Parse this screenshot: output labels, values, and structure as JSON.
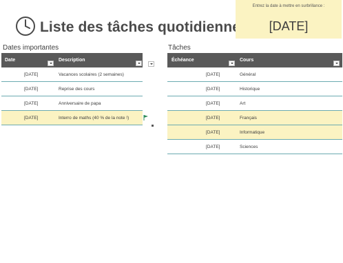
{
  "header": {
    "title": "Liste des tâches quotidiennes",
    "icon": "clock-icon"
  },
  "highlight": {
    "label": "Entrez la date à mettre en surbrillance :",
    "value": "[DATE]",
    "color": "#fbf3c2"
  },
  "important_dates": {
    "section_label": "Dates importantes",
    "columns": [
      "Date",
      "Description"
    ],
    "rows": [
      {
        "date": "[DATE]",
        "description": "Vacances scolaires (2 semaines)"
      },
      {
        "date": "[DATE]",
        "description": "Reprise des cours"
      },
      {
        "date": "[DATE]",
        "description": "Anniversaire de papa"
      },
      {
        "date": "[DATE]",
        "description": "Interro de maths (40 % de la note !)"
      }
    ]
  },
  "tasks": {
    "section_label": "Tâches",
    "columns": [
      "Échéance",
      "Cours"
    ],
    "rows": [
      {
        "due": "[DATE]",
        "course": "Général"
      },
      {
        "due": "[DATE]",
        "course": "Historique"
      },
      {
        "due": "[DATE]",
        "course": "Art"
      },
      {
        "due": "[DATE]",
        "course": "Français"
      },
      {
        "due": "[DATE]",
        "course": "Informatique"
      },
      {
        "due": "[DATE]",
        "course": "Sciences"
      }
    ]
  },
  "colors": {
    "header_bg": "#595959",
    "row_highlight": "#fbf3c2",
    "row_border": "#6aaab0",
    "flag": "#2e8b57"
  }
}
